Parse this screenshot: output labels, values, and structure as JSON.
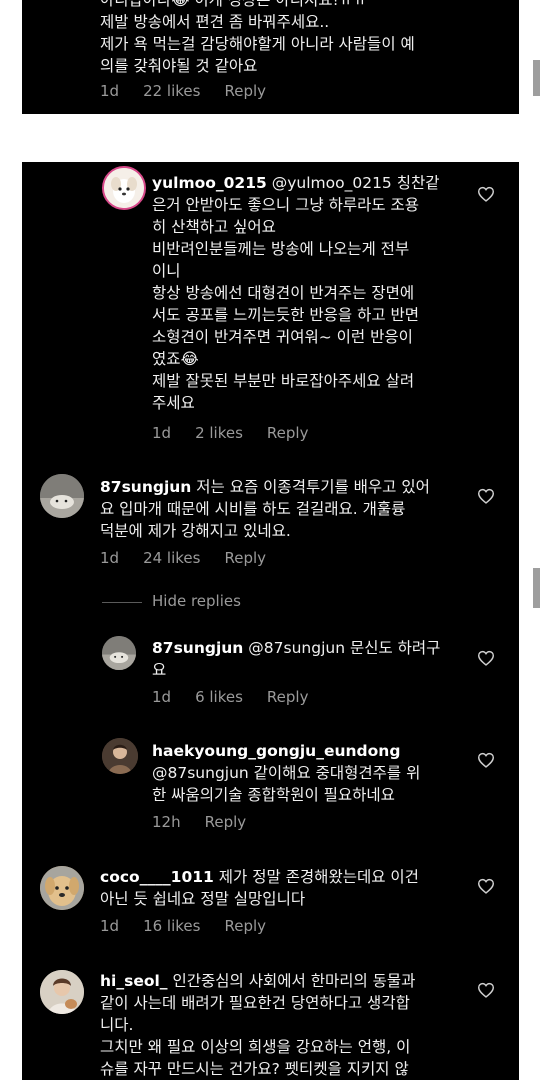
{
  "top_comment": {
    "lines": [
      "아니잡아라😂 이게 정상은 아니지요!ㅠㅠ",
      "제발 방송에서 편견 좀 바꿔주세요..",
      "제가 욕 먹는걸 감당해야할게 아니라 사람들이 예",
      "의를 갖춰야될 것 같아요"
    ],
    "time": "1d",
    "likes": "22 likes",
    "reply": "Reply"
  },
  "comments": [
    {
      "username": "yulmoo_0215",
      "lines": [
        "@yulmoo_0215 칭찬같",
        "은거 안받아도 좋으니 그냥 하루라도 조용",
        "히 산책하고 싶어요",
        "비반려인분들께는 방송에 나오는게 전부",
        "이니",
        "항상 방송에선 대형견이 반겨주는 장면에",
        "서도 공포를 느끼는듯한 반응을 하고 반면",
        "소형견이 반겨주면 귀여워~ 이런 반응이",
        "였죠😂",
        "제발 잘못된 부분만 바로잡아주세요 살려",
        "주세요"
      ],
      "time": "1d",
      "likes": "2 likes",
      "reply": "Reply"
    },
    {
      "username": "87sungjun",
      "lines": [
        "저는 요즘 이종격투기를 배우고 있어",
        "요 입마개 때문에 시비를 하도 걸길래요. 개훌륭",
        "덕분에 제가 강해지고 있네요."
      ],
      "time": "1d",
      "likes": "24 likes",
      "reply": "Reply",
      "hide_replies": "Hide replies"
    },
    {
      "username": "87sungjun",
      "lines": [
        "@87sungjun 문신도 하려구",
        "요"
      ],
      "time": "1d",
      "likes": "6 likes",
      "reply": "Reply"
    },
    {
      "username": "haekyoung_gongju_eundong",
      "lines": [
        "",
        "@87sungjun 같이해요 중대형견주를 위",
        "한 싸움의기술 종합학원이 필요하네요"
      ],
      "time": "12h",
      "reply": "Reply"
    },
    {
      "username": "coco____1011",
      "lines": [
        "제가 정말 존경해왔는데요 이건",
        "아닌 듯 쉽네요 정말 실망입니다"
      ],
      "time": "1d",
      "likes": "16 likes",
      "reply": "Reply"
    },
    {
      "username": "hi_seol_",
      "lines": [
        "인간중심의 사회에서 한마리의 동물과",
        "같이 사는데 배려가 필요한건 당연하다고 생각합",
        "니다.",
        "그치만 왜 필요 이상의 희생을 강요하는 언행, 이",
        "슈를 자꾸 만드시는 건가요? 펫티켓을 지키지 않"
      ]
    }
  ],
  "icons": {
    "like": "heart-outline-icon"
  },
  "colors": {
    "panel_bg": "#000000",
    "page_bg": "#ffffff",
    "text": "#f0f0f0",
    "meta": "#9a9a9a"
  }
}
